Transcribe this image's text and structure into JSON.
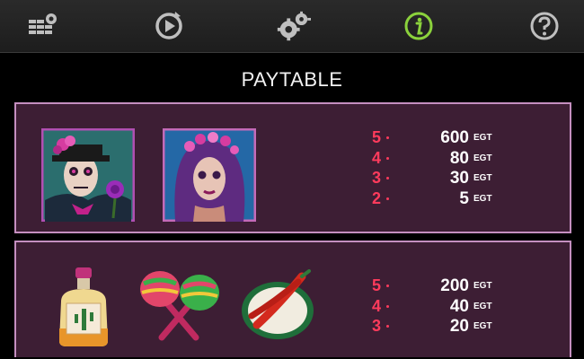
{
  "toolbar": {
    "buttons": [
      {
        "name": "menu-settings-icon"
      },
      {
        "name": "autoplay-icon"
      },
      {
        "name": "settings-icon"
      },
      {
        "name": "info-icon",
        "active": true
      },
      {
        "name": "help-icon"
      }
    ],
    "active_color": "#8bd23c",
    "icon_color": "#bfbfbf"
  },
  "title": "PAYTABLE",
  "panels": [
    {
      "symbols": [
        "calavera-man-symbol",
        "catrina-woman-symbol"
      ],
      "payouts": [
        {
          "count": "5",
          "amount": "600",
          "currency": "EGT"
        },
        {
          "count": "4",
          "amount": "80",
          "currency": "EGT"
        },
        {
          "count": "3",
          "amount": "30",
          "currency": "EGT"
        },
        {
          "count": "2",
          "amount": "5",
          "currency": "EGT"
        }
      ]
    },
    {
      "symbols": [
        "tequila-bottle-symbol",
        "maracas-symbol",
        "chili-pepper-plate-symbol"
      ],
      "payouts": [
        {
          "count": "5",
          "amount": "200",
          "currency": "EGT"
        },
        {
          "count": "4",
          "amount": "40",
          "currency": "EGT"
        },
        {
          "count": "3",
          "amount": "20",
          "currency": "EGT"
        }
      ]
    }
  ],
  "colors": {
    "panel_bg": "#3d1e34",
    "panel_border": "#c58fc0",
    "count": "#ff3b5c"
  }
}
